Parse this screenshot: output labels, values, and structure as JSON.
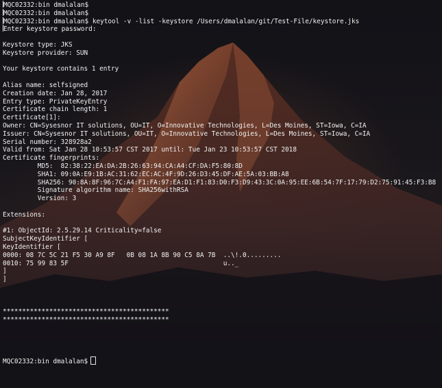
{
  "terminal": {
    "lines": [
      "MQC02332:bin dmalalan$",
      "MQC02332:bin dmalalan$",
      "MQC02332:bin dmalalan$ keytool -v -list -keystore /Users/dmalalan/git/Test-File/keystore.jks",
      "Enter keystore password:",
      "",
      "Keystore type: JKS",
      "Keystore provider: SUN",
      "",
      "Your keystore contains 1 entry",
      "",
      "Alias name: selfsigned",
      "Creation date: Jan 28, 2017",
      "Entry type: PrivateKeyEntry",
      "Certificate chain length: 1",
      "Certificate[1]:",
      "Owner: CN=Sysesnor IT solutions, OU=IT, O=Innovative Technologies, L=Des Moines, ST=Iowa, C=IA",
      "Issuer: CN=Sysesnor IT solutions, OU=IT, O=Innovative Technologies, L=Des Moines, ST=Iowa, C=IA",
      "Serial number: 328928a2",
      "Valid from: Sat Jan 28 10:53:57 CST 2017 until: Tue Jan 23 10:53:57 CST 2018",
      "Certificate fingerprints:",
      "         MD5:  82:38:22:EA:DA:2B:26:63:94:CA:A4:CF:DA:F5:80:8D",
      "         SHA1: 09:0A:E9:1B:AC:31:62:EC:AC:4F:9D:26:D3:45:DF:AE:5A:03:BB:A8",
      "         SHA256: 90:8A:8F:96:7C:A4:F1:FA:97:EA:D1:F1:83:D0:F3:D9:43:3C:0A:95:EE:6B:54:7F:17:79:D2:75:91:45:F3:B8",
      "         Signature algorithm name: SHA256withRSA",
      "         Version: 3",
      "",
      "Extensions:",
      "",
      "#1: ObjectId: 2.5.29.14 Criticality=false",
      "SubjectKeyIdentifier [",
      "KeyIdentifier [",
      "0000: 08 7C 5C 21 F5 30 A9 8F   0B 08 1A 8B 90 C5 8A 7B  ..\\!.0.........",
      "0010: 75 99 83 5F                                        u.._",
      "]",
      "]",
      "",
      "",
      "",
      "*******************************************",
      "*******************************************",
      "",
      "",
      "",
      ""
    ],
    "final_prompt": "MQC02332:bin dmalalan$"
  },
  "colors": {
    "text": "#f2f2f2",
    "background": "#15151b",
    "glow": "#af603a"
  },
  "icons": {
    "cursor": "block-cursor"
  }
}
